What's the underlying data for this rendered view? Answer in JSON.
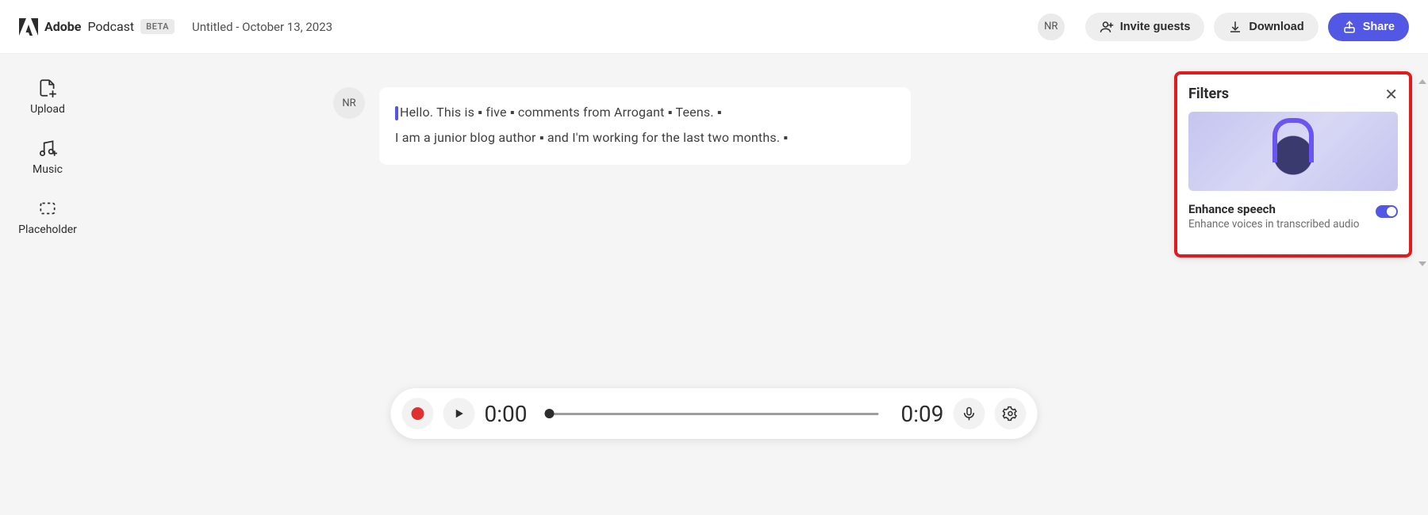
{
  "header": {
    "brand_strong": "Adobe",
    "brand_light": "Podcast",
    "beta": "BETA",
    "doc_title": "Untitled - October 13, 2023",
    "avatar_initials": "NR",
    "invite_label": "Invite guests",
    "download_label": "Download",
    "share_label": "Share"
  },
  "sidebar": {
    "items": [
      {
        "label": "Upload"
      },
      {
        "label": "Music"
      },
      {
        "label": "Placeholder"
      }
    ]
  },
  "transcript": {
    "speaker_initials": "NR",
    "line1": "Hello.  This  is ▪ five ▪ comments  from  Arrogant ▪ Teens. ▪",
    "line2": "I  am  a  junior  blog  author ▪ and  I'm  working  for  the  last  two  months. ▪"
  },
  "filters": {
    "title": "Filters",
    "enhance_label": "Enhance speech",
    "enhance_desc": "Enhance voices in transcribed audio",
    "enhance_on": true
  },
  "player": {
    "current_time": "0:00",
    "total_time": "0:09"
  }
}
